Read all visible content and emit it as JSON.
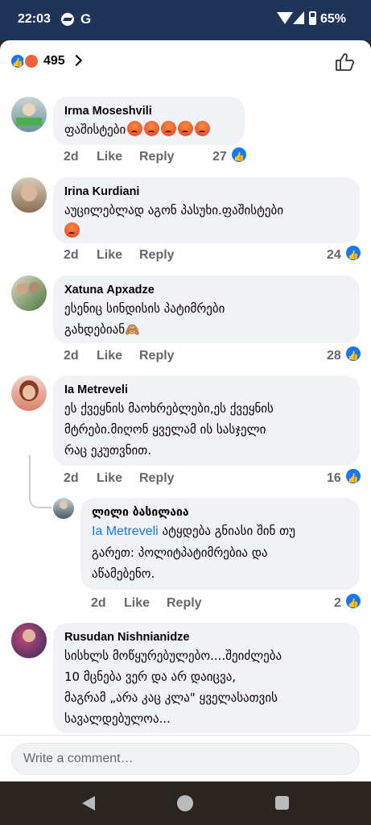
{
  "status_bar": {
    "time": "22:03",
    "g_label": "G",
    "battery": "65%"
  },
  "header": {
    "reaction_count": "495",
    "like_emoji": "👍"
  },
  "comments": [
    {
      "author": "Irma Moseshvili",
      "text": "ფაშისტები",
      "angry_count": 5,
      "time": "2d",
      "like_label": "Like",
      "reply_label": "Reply",
      "likes": "27",
      "avatar_colors": [
        "#6d8f9c",
        "#d8c9a3"
      ]
    },
    {
      "author": "Irina Kurdiani",
      "line1": "აუცილებლად აგონ პასუხი.ფაშისტები",
      "time": "2d",
      "like_label": "Like",
      "reply_label": "Reply",
      "likes": "24",
      "avatar_colors": [
        "#c6b7a3",
        "#8a6f55"
      ]
    },
    {
      "author": "Xatuna Архadze",
      "line1": "ესენიც სინდისის პატიმრები",
      "line2": "გახდებიან",
      "emoji": "🙈",
      "time": "2d",
      "like_label": "Like",
      "reply_label": "Reply",
      "likes": "28",
      "avatar_colors": [
        "#4a7a3a",
        "#e0d7c6"
      ]
    },
    {
      "author": "Ia Metreveli",
      "line1": "ეს ქვეყნის მაოხრებლები,ეს ქვეყნის",
      "line2": "მტრები.მიღონ ყველამ ის სასჯელი",
      "line3": "რაც ეკუთვნით.",
      "time": "2d",
      "like_label": "Like",
      "reply_label": "Reply",
      "likes": "16",
      "avatar_colors": [
        "#d9826a",
        "#8a3b2a"
      ]
    },
    {
      "author": "ლილი ბასილაია",
      "mention": "Ia Metreveli",
      "line1": "ატყდება გნიასი შინ თუ",
      "line2": "გარეთ: პოლიტპატიმრებია და",
      "line3": "აწამებენო.",
      "time": "2d",
      "like_label": "Like",
      "reply_label": "Reply",
      "likes": "2",
      "avatar_colors": [
        "#9aa8b5",
        "#4b5a68"
      ]
    },
    {
      "author": "Rusudan Nishnianidze",
      "line1": "სისხლს მოწყურებულებო....შეიძლება",
      "line2": "10 მცნება ვერ და არ დაიცვა,",
      "line3": "მაგრამ  „არა კაც კლა\" ყველასათვის",
      "line4": "სავალდებულოა...",
      "avatar_colors": [
        "#5b4a8a",
        "#c44a7a"
      ]
    }
  ],
  "composer": {
    "placeholder": "Write a comment…"
  }
}
